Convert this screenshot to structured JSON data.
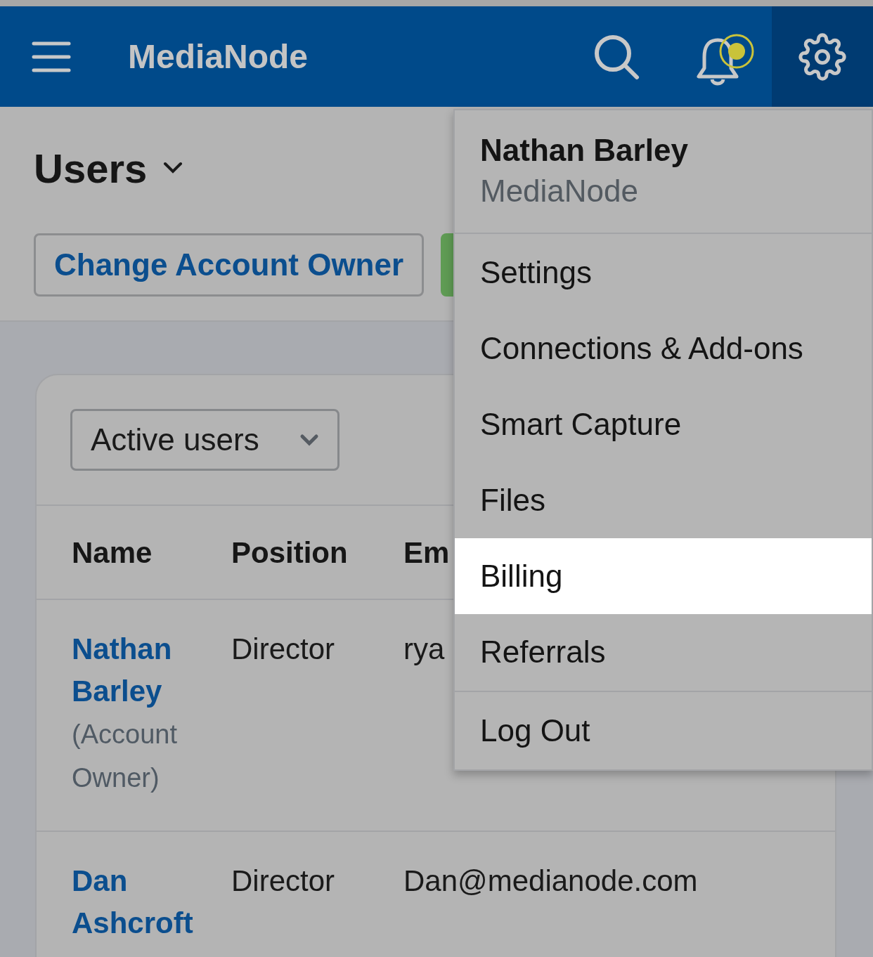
{
  "header": {
    "title": "MediaNode",
    "has_notification": true
  },
  "page": {
    "title": "Users",
    "buttons": [
      "Change Account Owner"
    ]
  },
  "filter": {
    "value": "Active users"
  },
  "table": {
    "columns": [
      "Name",
      "Position",
      "Em"
    ],
    "rows": [
      {
        "name": "Nathan Barley",
        "note": "(Account Owner)",
        "position": "Director",
        "email": "rya"
      },
      {
        "name": "Dan Ashcroft",
        "position": "Director",
        "email": "Dan@medianode.com"
      }
    ]
  },
  "menu": {
    "user": "Nathan Barley",
    "org": "MediaNode",
    "sections": [
      [
        {
          "label": "Settings",
          "selected": false
        },
        {
          "label": "Connections & Add-ons",
          "selected": false
        },
        {
          "label": "Smart Capture",
          "selected": false
        },
        {
          "label": "Files",
          "selected": false
        },
        {
          "label": "Billing",
          "selected": true
        },
        {
          "label": "Referrals",
          "selected": false
        }
      ],
      [
        {
          "label": "Log Out",
          "selected": false
        }
      ]
    ]
  }
}
